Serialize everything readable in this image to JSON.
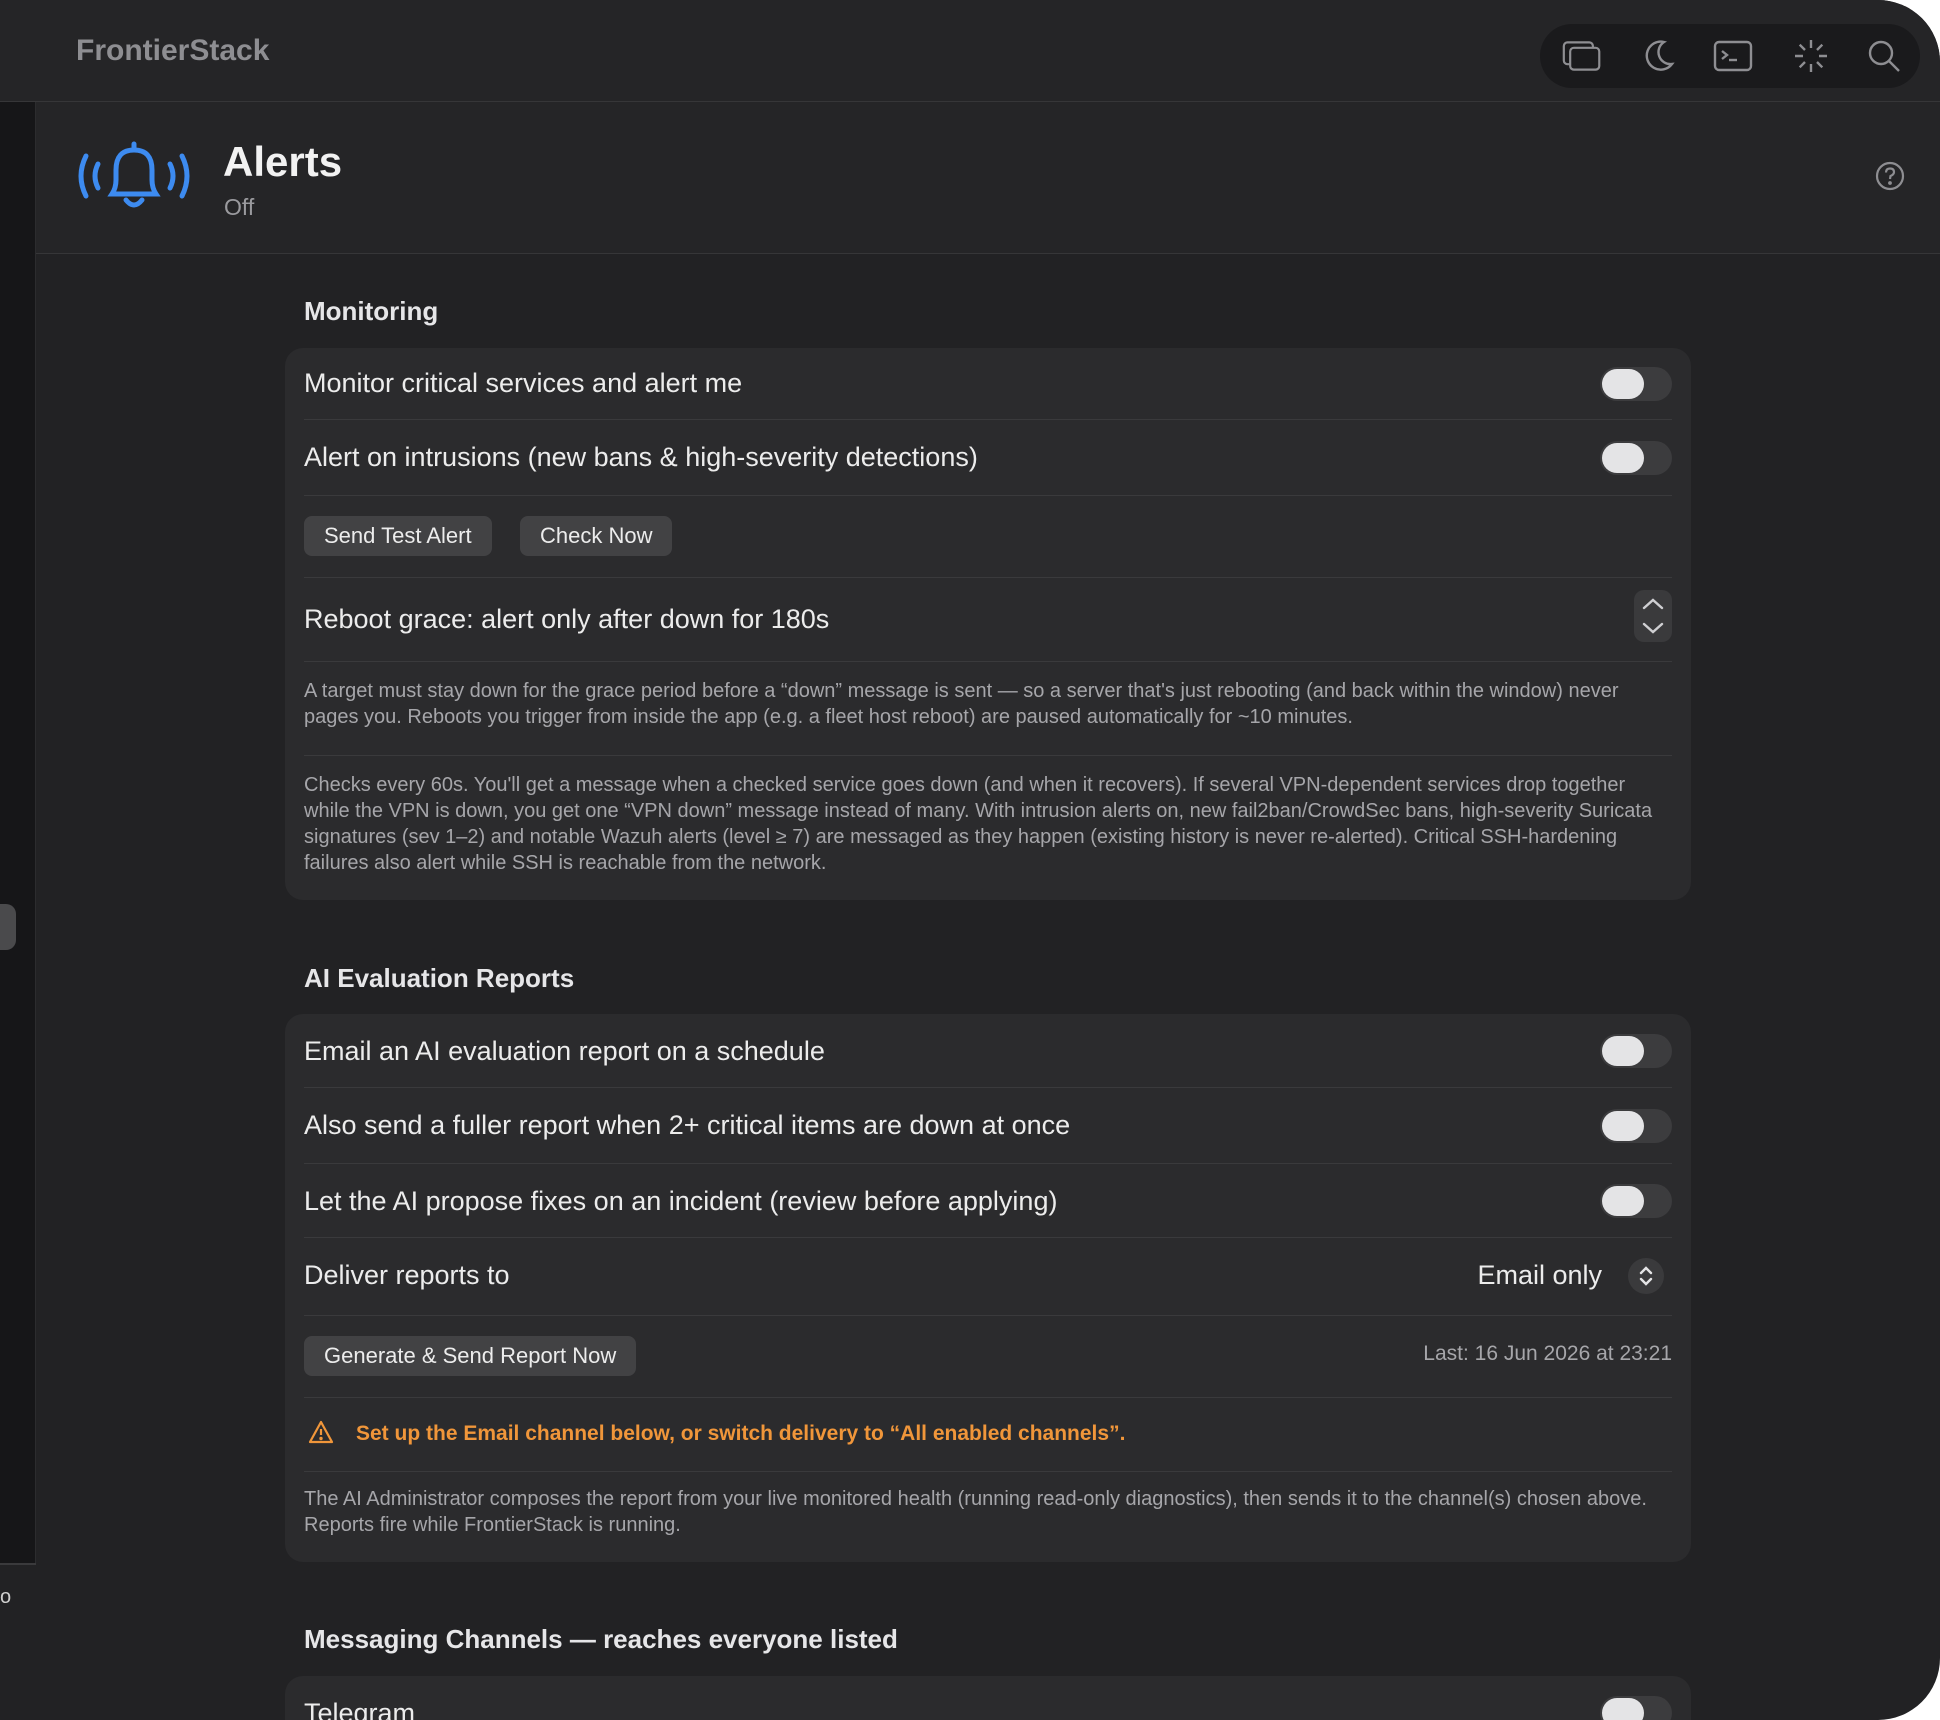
{
  "app": {
    "title": "FrontierStack"
  },
  "toolbar": {
    "icons": [
      "windows-icon",
      "moon-icon",
      "terminal-icon",
      "sparkle-icon",
      "search-icon"
    ]
  },
  "header": {
    "title": "Alerts",
    "status": "Off",
    "icon": "bell-alert-icon"
  },
  "monitoring": {
    "title": "Monitoring",
    "monitor_services_label": "Monitor critical services and alert me",
    "monitor_services_on": false,
    "intrusions_label": "Alert on intrusions (new bans & high-severity detections)",
    "intrusions_on": false,
    "send_test_label": "Send Test Alert",
    "check_now_label": "Check Now",
    "reboot_grace_label": "Reboot grace: alert only after down for 180s",
    "grace_help": "A target must stay down for the grace period before a “down” message is sent — so a server that's just rebooting (and back within the window) never pages you. Reboots you trigger from inside the app (e.g. a fleet host reboot) are paused automatically for ~10 minutes.",
    "checks_help": "Checks every 60s. You'll get a message when a checked service goes down (and when it recovers). If several VPN-dependent services drop together while the VPN is down, you get one “VPN down” message instead of many. With intrusion alerts on, new fail2ban/CrowdSec bans, high-severity Suricata signatures (sev 1–2) and notable Wazuh alerts (level ≥ 7) are messaged as they happen (existing history is never re-alerted). Critical SSH-hardening failures also alert while SSH is reachable from the network."
  },
  "ai_reports": {
    "title": "AI Evaluation Reports",
    "schedule_label": "Email an AI evaluation report on a schedule",
    "schedule_on": false,
    "fuller_label": "Also send a fuller report when 2+ critical items are down at once",
    "fuller_on": false,
    "propose_label": "Let the AI propose fixes on an incident (review before applying)",
    "propose_on": false,
    "deliver_label": "Deliver reports to",
    "deliver_value": "Email only",
    "generate_label": "Generate & Send Report Now",
    "last_text": "Last: 16 Jun 2026 at 23:21",
    "warning": "Set up the Email channel below, or switch delivery to “All enabled channels”.",
    "help": "The AI Administrator composes the report from your live monitored health (running read-only diagnostics), then sends it to the channel(s) chosen above. Reports fire while FrontierStack is running."
  },
  "channels": {
    "title": "Messaging Channels — reaches everyone listed",
    "telegram_label": "Telegram",
    "telegram_on": false
  },
  "sidebar": {
    "bottom_glyph": "o"
  },
  "colors": {
    "accent": "#3d8bf0",
    "warning": "#f0963a",
    "background": "#222224",
    "card": "#2b2b2d"
  }
}
